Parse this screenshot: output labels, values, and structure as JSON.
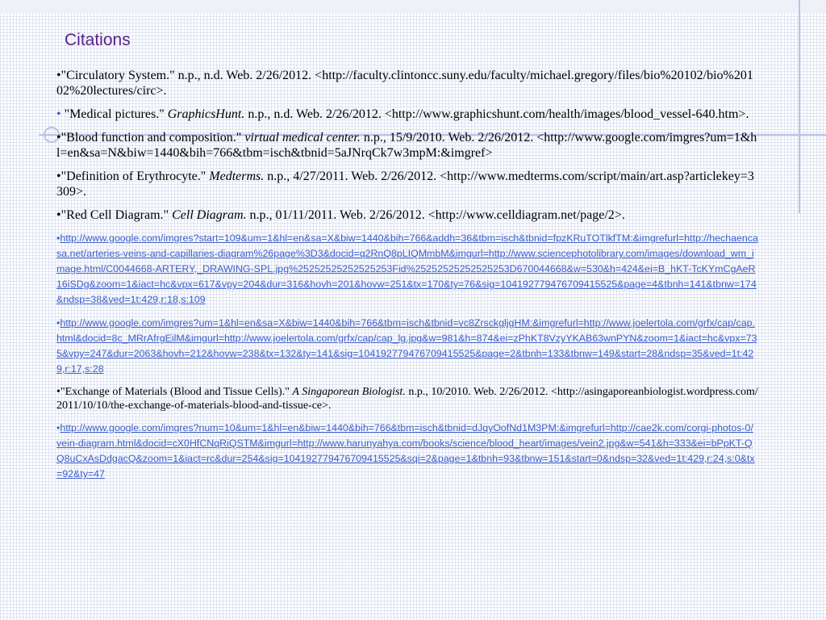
{
  "slide": {
    "title": "Citations",
    "colors": {
      "title": "#5b1f8e",
      "link": "#3d5ecb",
      "accent_line": "#b9c4e3"
    },
    "entries": [
      {
        "bullet": "•",
        "title_text": "\"Circulatory System.\"",
        "italic_text": "",
        "rest_text": " n.p., n.d. Web. 2/26/2012. <http://faculty.clintoncc.suny.edu/faculty/michael.gregory/files/bio%20102/bio%20102%20lectures/circ>."
      },
      {
        "bullet": "•",
        "title_text": " \"Medical pictures.\" ",
        "italic_text": "GraphicsHunt.",
        "rest_text": " n.p., n.d. Web. 2/26/2012. <http://www.graphicshunt.com/health/images/blood_vessel-640.htm>."
      },
      {
        "bullet": "•",
        "title_text": "\"Blood function and composition.\" ",
        "italic_text": "virtual medical center.",
        "rest_text": " n.p., 15/9/2010. Web. 2/26/2012. <http://www.google.com/imgres?um=1&hl=en&sa=N&biw=1440&bih=766&tbm=isch&tbnid=5aJNrqCk7w3mpM:&imgref>"
      },
      {
        "bullet": "•",
        "title_text": "\"Definition of Erythrocyte.\" ",
        "italic_text": "Medterms.",
        "rest_text": " n.p., 4/27/2011. Web. 2/26/2012. <http://www.medterms.com/script/main/art.asp?articlekey=3309>."
      },
      {
        "bullet": "•",
        "title_text": "\"Red Cell Diagram.\" ",
        "italic_text": "Cell Diagram.",
        "rest_text": " n.p., 01/11/2011. Web. 2/26/2012. <http://www.celldiagram.net/page/2>."
      }
    ],
    "links": [
      {
        "bullet": "•",
        "url": "http://www.google.com/imgres?start=109&um=1&hl=en&sa=X&biw=1440&bih=766&addh=36&tbm=isch&tbnid=fpzKRuTOTlkfTM:&imgrefurl=http://hechaencasa.net/arteries-veins-and-capillaries-diagram%26page%3D3&docid=q2RnQ8pLIQMmbM&imgurl=http://www.sciencephotolibrary.com/images/download_wm_image.html/C0044668-ARTERY,_DRAWING-SPL.jpg%25252525252525253Fid%25252525252525253D670044668&w=530&h=424&ei=B_hKT-TcKYmCgAeR16iSDg&zoom=1&iact=hc&vpx=617&vpy=204&dur=316&hovh=201&hovw=251&tx=170&ty=76&sig=104192779476709415525&page=4&tbnh=141&tbnw=174&ndsp=38&ved=1t:429,r:18,s:109"
      },
      {
        "bullet": "•",
        "url": "http://www.google.com/imgres?um=1&hl=en&sa=X&biw=1440&bih=766&tbm=isch&tbnid=vc8ZrsckgljgHM:&imgrefurl=http://www.joelertola.com/grfx/cap/cap.html&docid=8c_MRrAfrgEilM&imgurl=http://www.joelertola.com/grfx/cap/cap_lg.jpg&w=981&h=874&ei=zPhKT8VzyYKAB63wnPYN&zoom=1&iact=hc&vpx=735&vpy=247&dur=2063&hovh=212&hovw=238&tx=132&ty=141&sig=104192779476709415525&page=2&tbnh=133&tbnw=149&start=28&ndsp=35&ved=1t:429,r:17,s:28"
      }
    ],
    "exchange_entry": {
      "bullet": "•",
      "title_text": "\"Exchange of Materials (Blood and Tissue Cells).\" ",
      "italic_text": "A Singaporean Biologist.",
      "rest_text": " n.p., 10/2010. Web. 2/26/2012. <http://asingaporeanbiologist.wordpress.com/2011/10/10/the-exchange-of-materials-blood-and-tissue-ce>."
    },
    "last_link": {
      "bullet": "•",
      "url": "http://www.google.com/imgres?num=10&um=1&hl=en&biw=1440&bih=766&tbm=isch&tbnid=dJqyOofNd1M3PM:&imgrefurl=http://cae2k.com/corgi-photos-0/vein-diagram.html&docid=cX0HfCNqRiQSTM&imgurl=http://www.harunyahya.com/books/science/blood_heart/images/vein2.jpg&w=541&h=333&ei=bPpKT-QQ8uCxAsDdgacQ&zoom=1&iact=rc&dur=254&sig=104192779476709415525&sqi=2&page=1&tbnh=93&tbnw=151&start=0&ndsp=32&ved=1t:429,r:24,s:0&tx=92&ty=47"
    }
  }
}
